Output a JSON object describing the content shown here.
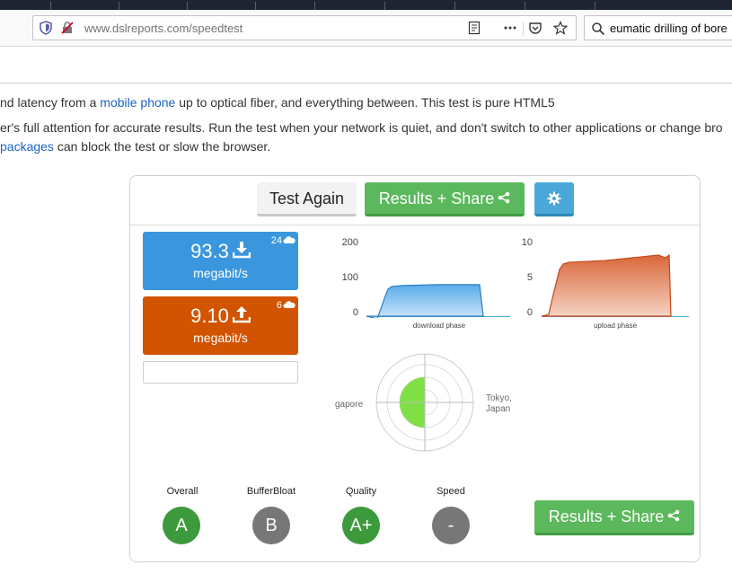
{
  "browser": {
    "url": "www.dslreports.com/speedtest",
    "search_text": "eumatic drilling of bore"
  },
  "page": {
    "line1": {
      "before": "nd latency from a ",
      "link": "mobile phone",
      "after": " up to optical fiber, and everything between. This test is pure HTML5"
    },
    "line2": "er's full attention for accurate results. Run the test when your network is quiet, and don't switch to other applications or change bro",
    "line3": {
      "link": "packages",
      "after": " can block the test or slow the browser."
    }
  },
  "speedtest": {
    "test_again_label": "Test Again",
    "results_share_label": "Results + Share",
    "download": {
      "value": "93.3",
      "unit": "megabit/s",
      "streams": "24"
    },
    "upload": {
      "value": "9.10",
      "unit": "megabit/s",
      "streams": "6"
    },
    "download_chart": {
      "y_ticks": [
        "200",
        "100",
        "0"
      ],
      "ymax": 200,
      "phase_label": "download phase",
      "level": 90
    },
    "upload_chart": {
      "y_ticks": [
        "10",
        "5",
        "0"
      ],
      "ymax": 10,
      "phase_label": "upload phase",
      "level": 8.2
    },
    "latency_map": {
      "left_city": "gapore",
      "right_city_line1": "Tokyo,",
      "right_city_line2": "Japan"
    },
    "grades": [
      {
        "label": "Overall",
        "grade": "A",
        "color": "#3c9a3c"
      },
      {
        "label": "BufferBloat",
        "grade": "B",
        "color": "#777777"
      },
      {
        "label": "Quality",
        "grade": "A+",
        "color": "#3c9a3c"
      },
      {
        "label": "Speed",
        "grade": "-",
        "color": "#777777"
      }
    ]
  },
  "colors": {
    "download": "#3b97dd",
    "upload": "#d35400",
    "green": "#5cb85c",
    "gear": "#4aa8d8"
  }
}
